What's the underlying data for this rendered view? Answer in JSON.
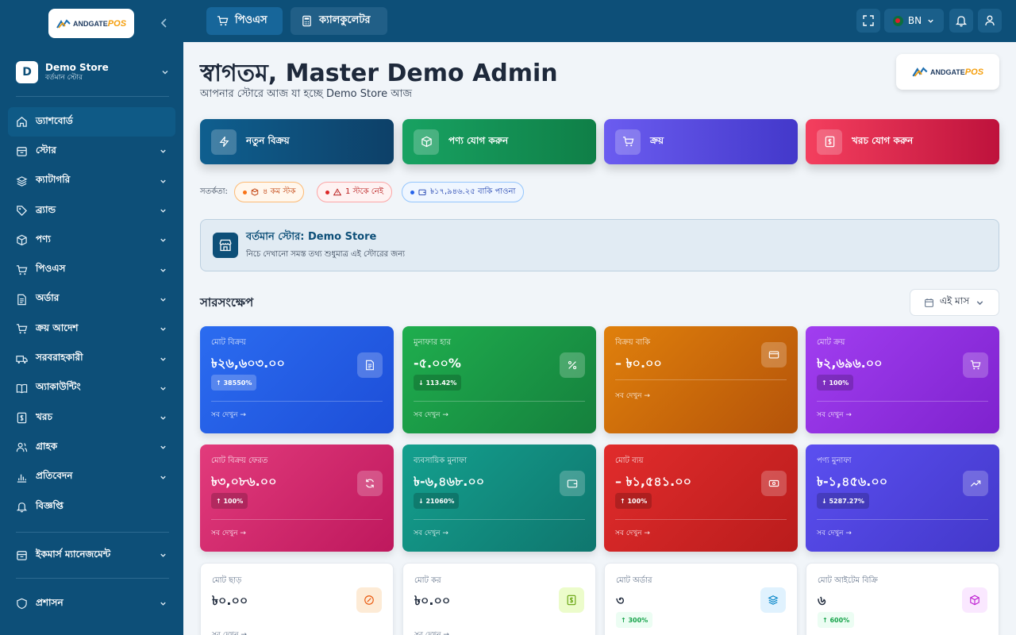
{
  "brand": {
    "logo_text": "ANDGATE",
    "logo_suffix": "POS"
  },
  "sidebar": {
    "store_initial": "D",
    "store_name": "Demo Store",
    "store_sub": "বর্তমান স্টোর",
    "items": [
      {
        "label": "ড্যাশবোর্ড",
        "icon": "home-icon"
      },
      {
        "label": "স্টোর",
        "icon": "store-icon"
      },
      {
        "label": "ক্যাটাগরি",
        "icon": "layers-icon"
      },
      {
        "label": "ব্র্যান্ড",
        "icon": "tag-icon"
      },
      {
        "label": "পণ্য",
        "icon": "box-icon"
      },
      {
        "label": "পিওএস",
        "icon": "cart-icon"
      },
      {
        "label": "অর্ডার",
        "icon": "document-icon"
      },
      {
        "label": "ক্রয় আদেশ",
        "icon": "cart-icon"
      },
      {
        "label": "সরবরাহকারী",
        "icon": "truck-icon"
      },
      {
        "label": "অ্যাকাউন্টিং",
        "icon": "book-icon"
      },
      {
        "label": "খরচ",
        "icon": "receipt-icon"
      },
      {
        "label": "গ্রাহক",
        "icon": "users-icon"
      },
      {
        "label": "প্রতিবেদন",
        "icon": "bar-chart-icon"
      },
      {
        "label": "বিজ্ঞপ্তি",
        "icon": "bell-icon"
      }
    ],
    "ecommerce": "ইকমার্স ম্যানেজমেন্ট",
    "admin": "প্রশাসন"
  },
  "topbar": {
    "pos": "পিওএস",
    "calculator": "ক্যালকুলেটর",
    "lang": "BN"
  },
  "header": {
    "welcome": "স্বাগতম, Master Demo Admin",
    "sub": "আপনার স্টোরে আজ যা হচ্ছে Demo Store আজ"
  },
  "actions": [
    {
      "label": "নতুন বিক্রয়",
      "icon": "bolt-icon",
      "bg": "#0d4f78"
    },
    {
      "label": "পণ্য যোগ করুন",
      "icon": "box-icon",
      "bg": "#16975a"
    },
    {
      "label": "ক্রয়",
      "icon": "cart-icon",
      "bg": "#5b50e6"
    },
    {
      "label": "খরচ যোগ করুন",
      "icon": "receipt-icon",
      "bg": "#e52849"
    }
  ],
  "alerts": {
    "label": "সতর্কতা:",
    "chips": [
      {
        "text": "৪ কম স্টক",
        "icon": "box-icon"
      },
      {
        "text": "1 স্টকে নেই",
        "icon": "warning-icon"
      },
      {
        "text": "৳১৭,৯৪৬.২৫ বাকি পাওনা",
        "icon": "wallet-icon"
      }
    ]
  },
  "current_store": {
    "title": "বর্তমান স্টোর: Demo Store",
    "sub": "নিচে দেখানো সমস্ত তথ্য শুধুমাত্র এই স্টোরের জন্য"
  },
  "summary": {
    "title": "সারসংক্ষেপ",
    "period": "এই মাস"
  },
  "see_all": "সব দেখুন →",
  "cards": [
    {
      "title": "মোট বিক্রয়",
      "value": "৳২৬,৬০৩.০০",
      "badge": "↑ 38550%",
      "icon": "document-icon",
      "color": "#2563eb"
    },
    {
      "title": "মুনাফার হার",
      "value": "-৫.০০%",
      "badge": "↓ 113.42%",
      "icon": "percent-icon",
      "color": "#16a34a"
    },
    {
      "title": "বিক্রয় বাকি",
      "value": "– ৳০.০০",
      "badge": "",
      "icon": "card-icon",
      "color": "#d97706"
    },
    {
      "title": "মোট ক্রয়",
      "value": "৳২,৬৯৬.০০",
      "badge": "↑ 100%",
      "icon": "cart-icon",
      "color": "#9333ea"
    },
    {
      "title": "মোট বিক্রয় ফেরত",
      "value": "৳৩,০৮৬.০০",
      "badge": "↑ 100%",
      "icon": "refresh-icon",
      "color": "#db2777"
    },
    {
      "title": "ব্যবসায়িক মুনাফা",
      "value": "৳-৬,৪৬৮.০০",
      "badge": "↓ 21060%",
      "icon": "wallet-icon",
      "color": "#0d9488"
    },
    {
      "title": "মোট ব্যয়",
      "value": "– ৳১,৫৪১.০০",
      "badge": "↑ 100%",
      "icon": "cash-icon",
      "color": "#dc2626"
    },
    {
      "title": "পণ্য মুনাফা",
      "value": "৳-১,৪৫৬.০০",
      "badge": "↓ 5287.27%",
      "icon": "trending-up-icon",
      "color": "#4f46e5"
    }
  ],
  "white_cards": [
    {
      "title": "মোট ছাড়",
      "value": "৳০.০০",
      "badge": "",
      "icon": "discount-icon",
      "icon_bg": "#fdebd6",
      "icon_color": "#ea580c"
    },
    {
      "title": "মোট কর",
      "value": "৳০.০০",
      "badge": "",
      "icon": "receipt-icon",
      "icon_bg": "#ecfccb",
      "icon_color": "#65a30d"
    },
    {
      "title": "মোট অর্ডার",
      "value": "৩",
      "badge": "↑ 300%",
      "icon": "layers-icon",
      "icon_bg": "#e0f2fe",
      "icon_color": "#0284c7"
    },
    {
      "title": "মোট আইটেম বিক্রি",
      "value": "৬",
      "badge": "↑ 600%",
      "icon": "box-icon",
      "icon_bg": "#fae8ff",
      "icon_color": "#c026d3"
    }
  ]
}
